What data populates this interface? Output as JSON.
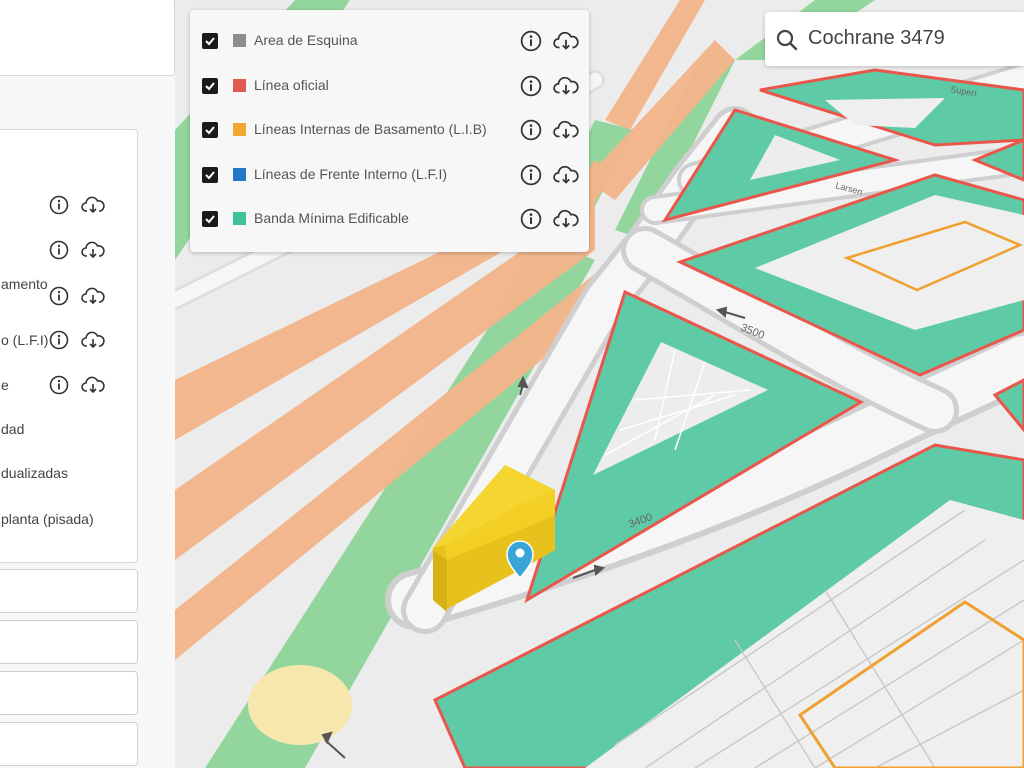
{
  "sidebar": {
    "items": [
      {
        "label": ""
      },
      {
        "label": ""
      },
      {
        "label": "amento"
      },
      {
        "label": "o (L.F.I)"
      },
      {
        "label": "e"
      },
      {
        "label": "dad"
      },
      {
        "label": "dualizadas"
      },
      {
        "label": "planta (pisada)"
      }
    ]
  },
  "layers": {
    "items": [
      {
        "label": "Area de Esquina",
        "color": "#8c8c8c",
        "checked": true
      },
      {
        "label": "Línea oficial",
        "color": "#e05a4f",
        "checked": true
      },
      {
        "label": "Líneas Internas de Basamento (L.I.B)",
        "color": "#f0a830",
        "checked": true
      },
      {
        "label": "Líneas de Frente Interno (L.F.I)",
        "color": "#2478c8",
        "checked": true
      },
      {
        "label": "Banda Mínima Edificable",
        "color": "#3ec29c",
        "checked": true
      }
    ]
  },
  "search": {
    "value": "Cochrane 3479"
  },
  "map": {
    "street_labels": [
      "3500",
      "3400",
      "Larsen",
      "Superí"
    ],
    "colors": {
      "band": "#5fcba6",
      "official_line": "#e9574c",
      "lib_line": "#f0a030",
      "highway": "#f2b488",
      "park": "#8fd49a",
      "building": "#f2d21f",
      "marker": "#3aa6d8"
    }
  }
}
